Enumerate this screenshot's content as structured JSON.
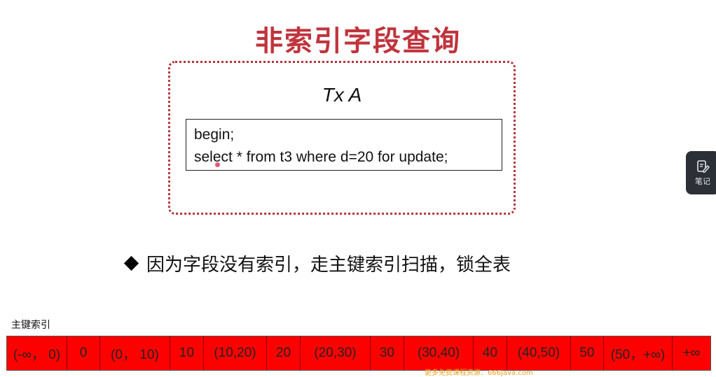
{
  "slide": {
    "title": "非索引字段查询",
    "tx_label": "Tx A",
    "code_lines": [
      "begin;",
      "select * from t3 where d=20 for update;"
    ],
    "bullet_text": "因为字段没有索引，走主键索引扫描，锁全表",
    "index_label": "主键索引",
    "index_cells": [
      "(-∞，  0)",
      "0",
      "(0，  10)",
      "10",
      "(10,20)",
      "20",
      "(20,30)",
      "30",
      "(30,40)",
      "40",
      "(40,50)",
      "50",
      "(50，+∞)",
      "+∞"
    ]
  },
  "side_panel": {
    "label": "笔记",
    "icon": "note-edit-icon"
  },
  "watermark": "更多免费课程资源：666java.com",
  "colors": {
    "title": "#c0343d",
    "dotted_border": "#b5343f",
    "index_fill": "#ff0000"
  }
}
